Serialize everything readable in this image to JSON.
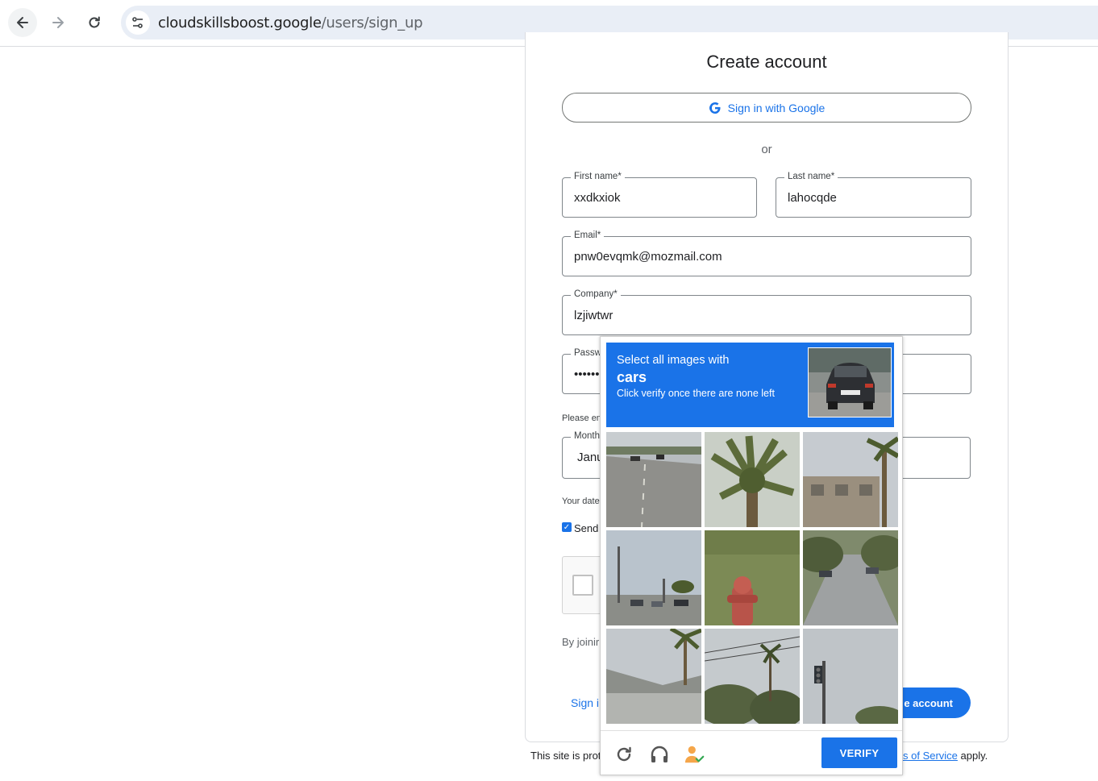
{
  "browser": {
    "url_host": "cloudskillsboost.google",
    "url_path": "/users/sign_up"
  },
  "form": {
    "title": "Create account",
    "google_button": "Sign in with Google",
    "or_text": "or",
    "first_name": {
      "label": "First name*",
      "value": "xxdkxiok"
    },
    "last_name": {
      "label": "Last name*",
      "value": "lahocqde"
    },
    "email": {
      "label": "Email*",
      "value": "pnw0evqmk@mozmail.com"
    },
    "company": {
      "label": "Company*",
      "value": "lzjiwtwr"
    },
    "password": {
      "label": "Passw",
      "value": "••••••"
    },
    "password_helper": "Please en",
    "month": {
      "label": "Month",
      "value": "Janu"
    },
    "dob_helper": "Your date",
    "send_checkbox_label": "Send",
    "send_checked": true,
    "by_joining": "By joinir",
    "sign_in_link": "Sign i",
    "create_button": "e account",
    "footer_left": "This site is prot",
    "footer_tos": "s of Service",
    "footer_apply": " apply."
  },
  "captcha": {
    "line1": "Select all images with",
    "target": "cars",
    "line3": "Click verify once there are none left",
    "verify_label": "VERIFY",
    "tiles": [
      "road-with-cars",
      "palm-tree",
      "building-palm",
      "street-cars",
      "fire-hydrant",
      "residential-street",
      "house-roof",
      "trees-power-lines",
      "traffic-light"
    ],
    "footer_icons": [
      "reload-icon",
      "audio-icon",
      "info-person-icon"
    ],
    "accent_color": "#1a73e8"
  }
}
